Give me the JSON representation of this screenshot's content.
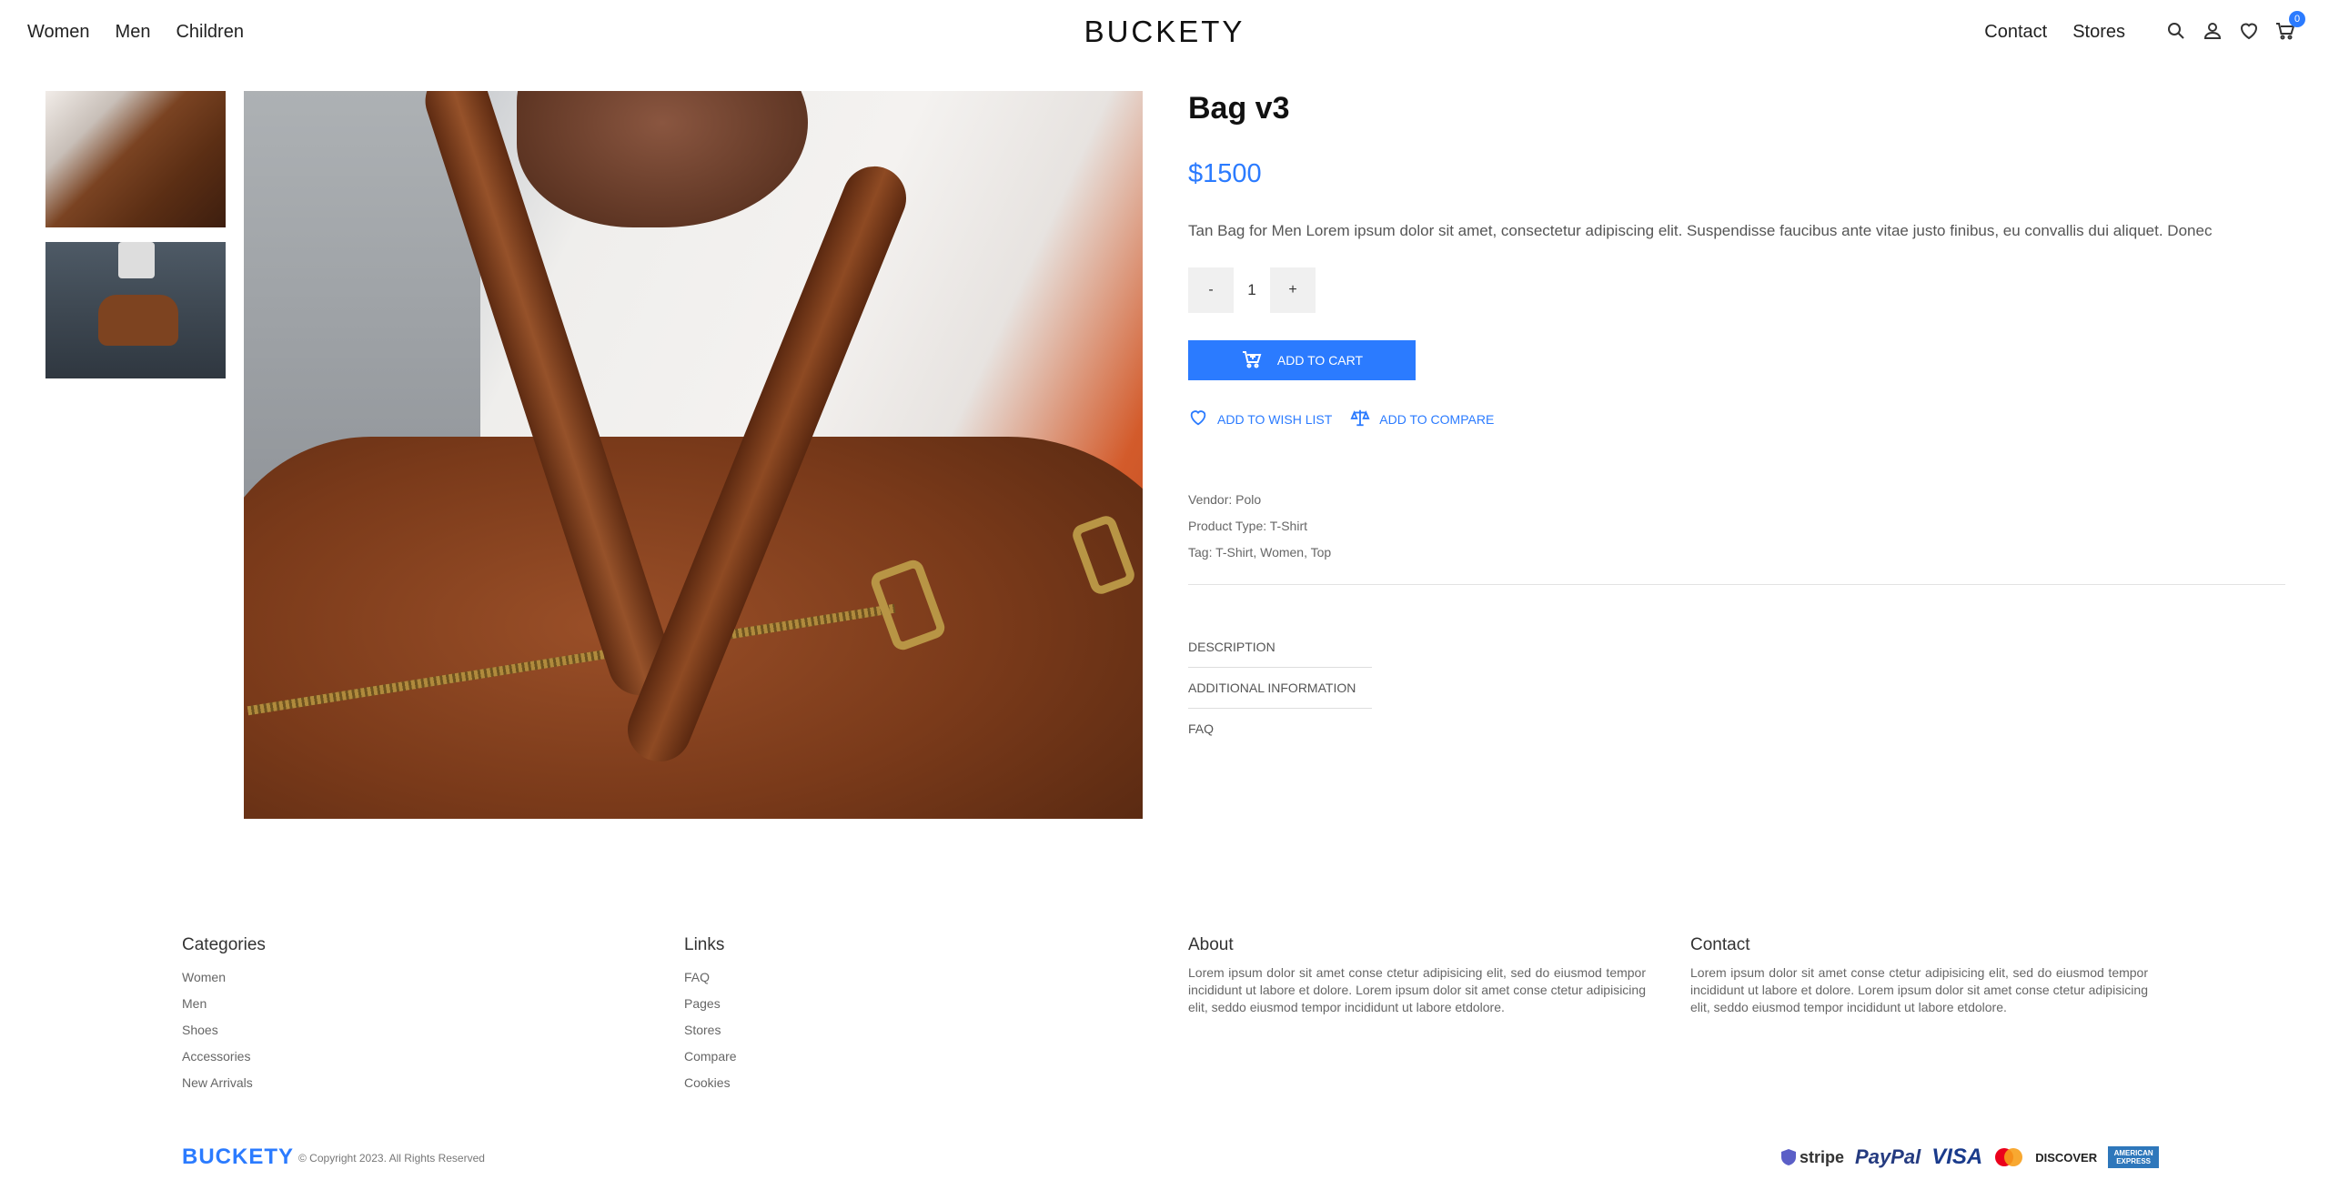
{
  "header": {
    "nav_left": [
      "Women",
      "Men",
      "Children"
    ],
    "logo": "BUCKETY",
    "nav_right": [
      "Contact",
      "Stores"
    ],
    "cart_count": "0",
    "icons": [
      "search-icon",
      "user-icon",
      "heart-icon",
      "cart-icon"
    ]
  },
  "product": {
    "title": "Bag v3",
    "price": "$1500",
    "description": "Tan Bag for Men Lorem ipsum dolor sit amet, consectetur adipiscing elit. Suspendisse faucibus ante vitae justo finibus, eu convallis dui aliquet. Donec",
    "qty_minus": "-",
    "qty_value": "1",
    "qty_plus": "+",
    "add_to_cart": "ADD TO CART",
    "wishlist": "ADD TO WISH LIST",
    "compare": "ADD TO COMPARE",
    "vendor": "Vendor: Polo",
    "product_type": "Product Type: T-Shirt",
    "tags": "Tag: T-Shirt, Women, Top",
    "tabs": [
      "DESCRIPTION",
      "ADDITIONAL INFORMATION",
      "FAQ"
    ]
  },
  "footer": {
    "categories": {
      "title": "Categories",
      "items": [
        "Women",
        "Men",
        "Shoes",
        "Accessories",
        "New Arrivals"
      ]
    },
    "links": {
      "title": "Links",
      "items": [
        "FAQ",
        "Pages",
        "Stores",
        "Compare",
        "Cookies"
      ]
    },
    "about": {
      "title": "About",
      "text": "Lorem ipsum dolor sit amet conse ctetur adipisicing elit, sed do eiusmod tempor incididunt ut labore et dolore. Lorem ipsum dolor sit amet conse ctetur adipisicing elit, seddo eiusmod tempor incididunt ut labore etdolore."
    },
    "contact": {
      "title": "Contact",
      "text": "Lorem ipsum dolor sit amet conse ctetur adipisicing elit, sed do eiusmod tempor incididunt ut labore et dolore. Lorem ipsum dolor sit amet conse ctetur adipisicing elit, seddo eiusmod tempor incididunt ut labore etdolore."
    },
    "logo": "BUCKETY",
    "copyright": "© Copyright 2023. All Rights Reserved",
    "payments": [
      "stripe",
      "PayPal",
      "VISA",
      "DISCOVER",
      "AMERICAN EXPRESS"
    ]
  },
  "colors": {
    "accent": "#2b7bff"
  }
}
